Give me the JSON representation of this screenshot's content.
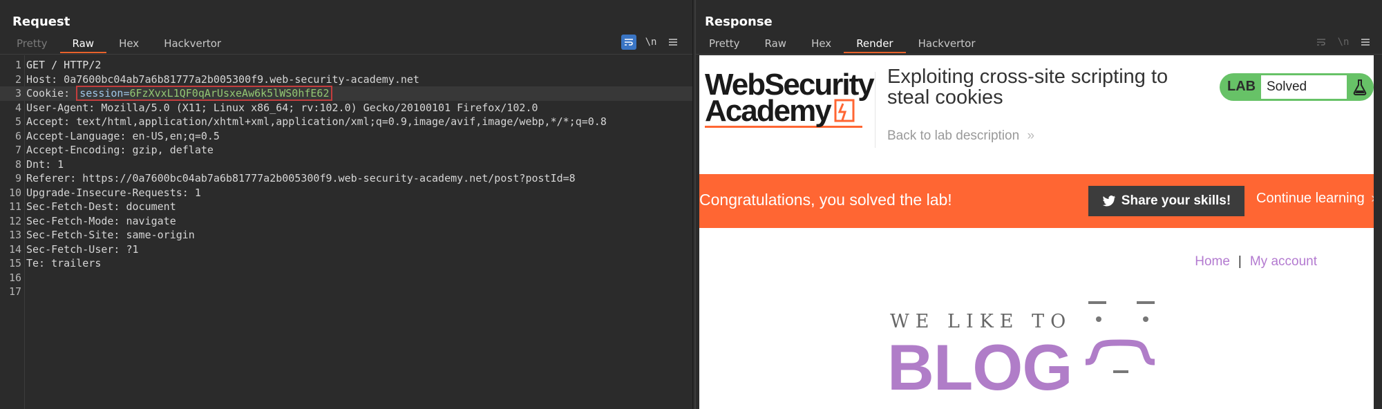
{
  "request": {
    "title": "Request",
    "tabs": [
      "Pretty",
      "Raw",
      "Hex",
      "Hackvertor"
    ],
    "active_tab": "Raw",
    "icons": [
      "wrap-lines-icon",
      "newline-icon",
      "menu-icon"
    ],
    "newline_label": "\\n",
    "lines": [
      {
        "n": "1",
        "text": "GET / HTTP/2"
      },
      {
        "n": "2",
        "key": "Host:",
        "val": " 0a7600bc04ab7a6b81777a2b005300f9.web-security-academy.net"
      },
      {
        "n": "3",
        "key": "Cookie:",
        "val": " ",
        "cookie_name": "session=",
        "cookie_value": "6FzXvxL1QF0qArUsxeAw6k5lWS0hfE62"
      },
      {
        "n": "4",
        "key": "User-Agent:",
        "val": " Mozilla/5.0 (X11; Linux x86_64; rv:102.0) Gecko/20100101 Firefox/102.0"
      },
      {
        "n": "5",
        "key": "Accept:",
        "val": " text/html,application/xhtml+xml,application/xml;q=0.9,image/avif,image/webp,*/*;q=0.8"
      },
      {
        "n": "6",
        "key": "Accept-Language:",
        "val": " en-US,en;q=0.5"
      },
      {
        "n": "7",
        "key": "Accept-Encoding:",
        "val": " gzip, deflate"
      },
      {
        "n": "8",
        "key": "Dnt:",
        "val": " 1"
      },
      {
        "n": "9",
        "key": "Referer:",
        "val": " https://0a7600bc04ab7a6b81777a2b005300f9.web-security-academy.net/post?postId=8"
      },
      {
        "n": "10",
        "key": "Upgrade-Insecure-Requests:",
        "val": " 1"
      },
      {
        "n": "11",
        "key": "Sec-Fetch-Dest:",
        "val": " document"
      },
      {
        "n": "12",
        "key": "Sec-Fetch-Mode:",
        "val": " navigate"
      },
      {
        "n": "13",
        "key": "Sec-Fetch-Site:",
        "val": " same-origin"
      },
      {
        "n": "14",
        "key": "Sec-Fetch-User:",
        "val": " ?1"
      },
      {
        "n": "15",
        "key": "Te:",
        "val": " trailers"
      },
      {
        "n": "16",
        "text": ""
      },
      {
        "n": "17",
        "text": ""
      }
    ]
  },
  "response": {
    "title": "Response",
    "tabs": [
      "Pretty",
      "Raw",
      "Hex",
      "Render",
      "Hackvertor"
    ],
    "active_tab": "Render",
    "icons": [
      "wrap-lines-icon",
      "newline-icon",
      "menu-icon"
    ],
    "newline_label": "\\n",
    "page": {
      "logo_line1": "WebSecurity",
      "logo_line2": "Academy",
      "lab_title": "Exploiting cross-site scripting to steal cookies",
      "back_link": "Back to lab description",
      "lab_label": "LAB",
      "lab_status": "Solved",
      "banner_message": "Congratulations, you solved the lab!",
      "share_label": "Share your skills!",
      "continue_label": "Continue learning",
      "nav": {
        "home": "Home",
        "separator": "|",
        "account": "My account"
      },
      "blog_tagline": "WE LIKE TO",
      "blog_word": "BLOG"
    }
  },
  "layout_buttons": [
    "split-vertical-icon",
    "split-horizontal-icon",
    "single-pane-icon"
  ],
  "colors": {
    "accent_tab": "#e8622b",
    "banner": "#ff6633",
    "lab_green": "#67c267",
    "link_purple": "#b37ad0",
    "cookie_value": "#93c773",
    "highlight_box": "#c43d3d"
  }
}
